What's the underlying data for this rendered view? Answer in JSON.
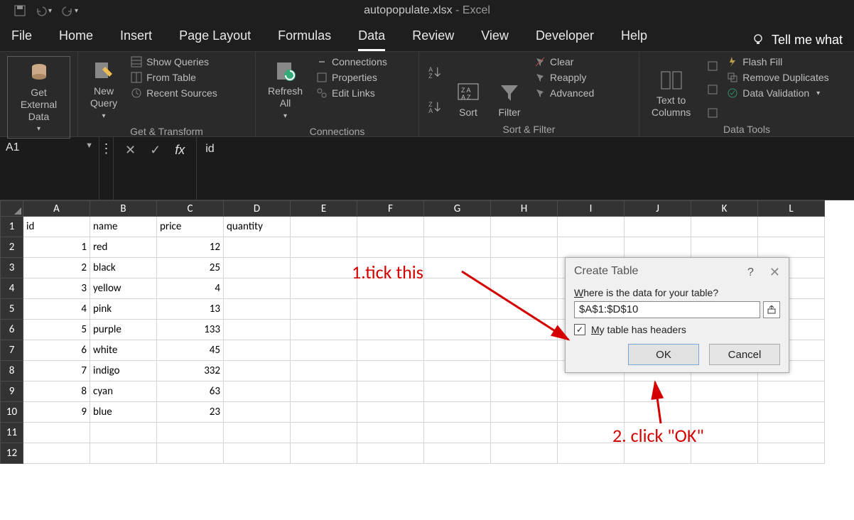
{
  "title": {
    "file": "autopopulate.xlsx",
    "sep": "  -  ",
    "app": "Excel"
  },
  "menu": {
    "items": [
      "File",
      "Home",
      "Insert",
      "Page Layout",
      "Formulas",
      "Data",
      "Review",
      "View",
      "Developer",
      "Help"
    ],
    "active": 5,
    "tell": "Tell me what"
  },
  "ribbon": {
    "g1": {
      "btn": "Get External\nData",
      "label": ""
    },
    "g2": {
      "btn": "New\nQuery",
      "a": "Show Queries",
      "b": "From Table",
      "c": "Recent Sources",
      "label": "Get & Transform"
    },
    "g3": {
      "btn": "Refresh\nAll",
      "a": "Connections",
      "b": "Properties",
      "c": "Edit Links",
      "label": "Connections"
    },
    "g4": {
      "sort": "Sort",
      "filter": "Filter",
      "a": "Clear",
      "b": "Reapply",
      "c": "Advanced",
      "label": "Sort & Filter"
    },
    "g5": {
      "btn": "Text to\nColumns",
      "a": "Flash Fill",
      "b": "Remove Duplicates",
      "c": "Data Validation",
      "label": "Data Tools"
    }
  },
  "formula": {
    "namebox": "A1",
    "content": "id",
    "fx": "fx"
  },
  "columns": [
    "A",
    "B",
    "C",
    "D",
    "E",
    "F",
    "G",
    "H",
    "I",
    "J",
    "K",
    "L"
  ],
  "rows": [
    "1",
    "2",
    "3",
    "4",
    "5",
    "6",
    "7",
    "8",
    "9",
    "10",
    "11",
    "12"
  ],
  "sheet": {
    "headers": [
      "id",
      "name",
      "price",
      "quantity"
    ],
    "data": [
      {
        "id": "1",
        "name": "red",
        "price": "12",
        "qty": ""
      },
      {
        "id": "2",
        "name": "black",
        "price": "25",
        "qty": ""
      },
      {
        "id": "3",
        "name": "yellow",
        "price": "4",
        "qty": ""
      },
      {
        "id": "4",
        "name": "pink",
        "price": "13",
        "qty": ""
      },
      {
        "id": "5",
        "name": "purple",
        "price": "133",
        "qty": ""
      },
      {
        "id": "6",
        "name": "white",
        "price": "45",
        "qty": ""
      },
      {
        "id": "7",
        "name": "indigo",
        "price": "332",
        "qty": ""
      },
      {
        "id": "8",
        "name": "cyan",
        "price": "63",
        "qty": ""
      },
      {
        "id": "9",
        "name": "blue",
        "price": "23",
        "qty": ""
      }
    ]
  },
  "dialog": {
    "title": "Create Table",
    "help": "?",
    "label_pre": "W",
    "label_post": "here is the data for your table?",
    "range": "$A$1:$D$10",
    "check_pre": "M",
    "check_post": "y table has headers",
    "ok": "OK",
    "cancel": "Cancel"
  },
  "anno": {
    "one": "1.tick this",
    "two": "2. click \"OK\""
  }
}
